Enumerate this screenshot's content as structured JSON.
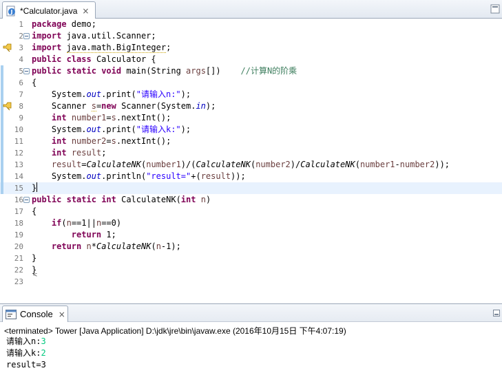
{
  "editor": {
    "tab_title": "*Calculator.java",
    "close_symbol": "×",
    "lines": [
      {
        "no": "1",
        "html": "<span class=\"kw\">package</span> demo;"
      },
      {
        "no": "2",
        "html": "<span class=\"kw\">import</span> java.util.Scanner;"
      },
      {
        "no": "3",
        "html": "<span class=\"kw\">import</span> <span class=\"warn-underline\">java.math.BigInteger</span>;"
      },
      {
        "no": "4",
        "html": "<span class=\"kw\">public</span> <span class=\"kw\">class</span> Calculator {"
      },
      {
        "no": "5",
        "html": "<span class=\"kw\">public</span> <span class=\"kw\">static</span> <span class=\"kw\">void</span> main(String <span class=\"lvar\">args</span>[])    <span class=\"cmt\">//计算N的阶乘</span>"
      },
      {
        "no": "6",
        "html": "{"
      },
      {
        "no": "7",
        "html": "    System.<span class=\"fld\">out</span>.print(<span class=\"str\">\"请输入n:\"</span>);"
      },
      {
        "no": "8",
        "html": "    Scanner <span class=\"lvar warn-underline\">s</span>=<span class=\"kw\">new</span> Scanner(System.<span class=\"fld\">in</span>);"
      },
      {
        "no": "9",
        "html": "    <span class=\"kw\">int</span> <span class=\"lvar\">number1</span>=<span class=\"lvar\">s</span>.nextInt();"
      },
      {
        "no": "10",
        "html": "    System.<span class=\"fld\">out</span>.print(<span class=\"str\">\"请输入k:\"</span>);"
      },
      {
        "no": "11",
        "html": "    <span class=\"kw\">int</span> <span class=\"lvar\">number2</span>=<span class=\"lvar\">s</span>.nextInt();"
      },
      {
        "no": "12",
        "html": "    <span class=\"kw\">int</span> <span class=\"lvar\">result</span>;"
      },
      {
        "no": "13",
        "html": "    <span class=\"lvar\">result</span>=<span class=\"static-m\">CalculateNK</span>(<span class=\"lvar\">number1</span>)/(<span class=\"static-m\">CalculateNK</span>(<span class=\"lvar\">number2</span>)/<span class=\"static-m\">CalculateNK</span>(<span class=\"lvar\">number1</span>-<span class=\"lvar\">number2</span>));"
      },
      {
        "no": "14",
        "html": "    System.<span class=\"fld\">out</span>.println(<span class=\"str\">\"result=\"</span>+(<span class=\"lvar\">result</span>));"
      },
      {
        "no": "15",
        "html": "}<span class=\"caret\"></span>"
      },
      {
        "no": "16",
        "html": "<span class=\"kw\">public</span> <span class=\"kw\">static</span> <span class=\"kw\">int</span> CalculateNK(<span class=\"kw\">int</span> <span class=\"lvar\">n</span>)"
      },
      {
        "no": "17",
        "html": "{"
      },
      {
        "no": "18",
        "html": "    <span class=\"kw\">if</span>(<span class=\"lvar\">n</span>==1||<span class=\"lvar\">n</span>==0)"
      },
      {
        "no": "19",
        "html": "        <span class=\"kw\">return</span> 1;"
      },
      {
        "no": "20",
        "html": "    <span class=\"kw\">return</span> <span class=\"lvar\">n</span>*<span class=\"static-m\">CalculateNK</span>(<span class=\"lvar\">n</span>-1);"
      },
      {
        "no": "21",
        "html": "}"
      },
      {
        "no": "22",
        "html": "}"
      },
      {
        "no": "23",
        "html": ""
      }
    ]
  },
  "console": {
    "tab_title": "Console",
    "close_symbol": "×",
    "status": "<terminated> Tower [Java Application] D:\\jdk\\jre\\bin\\javaw.exe (2016年10月15日 下午4:07:19)",
    "output": [
      {
        "prompt": "请输入n:",
        "input": "3"
      },
      {
        "prompt": "请输入k:",
        "input": "2"
      },
      {
        "prompt": "result=3",
        "input": ""
      }
    ]
  },
  "colors": {
    "keyword": "#7f0055",
    "string": "#2a00ff",
    "comment": "#3f7f5f",
    "current_line": "#e8f2fe",
    "console_input": "#00c87d"
  }
}
